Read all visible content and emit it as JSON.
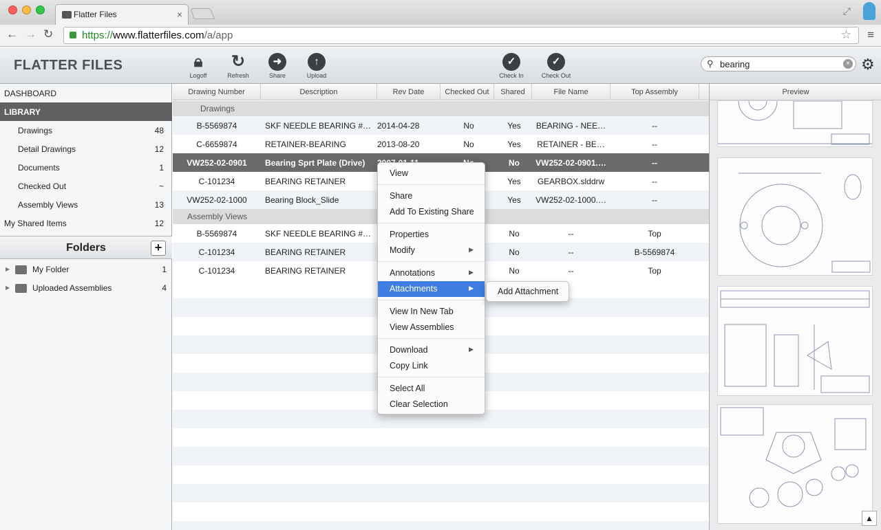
{
  "browser": {
    "tab_title": "Flatter Files",
    "url_scheme": "https://",
    "url_host": "www.flatterfiles.com",
    "url_path": "/a/app"
  },
  "app": {
    "logo": "FLATTER FILES",
    "toolbar": [
      {
        "label": "Logoff",
        "icon": "lock-icon"
      },
      {
        "label": "Refresh",
        "icon": "refresh-icon"
      },
      {
        "label": "Share",
        "icon": "share-arrow-icon"
      },
      {
        "label": "Upload",
        "icon": "upload-icon"
      }
    ],
    "toolbar_right": [
      {
        "label": "Check In",
        "icon": "check-circle-icon"
      },
      {
        "label": "Check Out",
        "icon": "check-circle-icon"
      }
    ],
    "search": {
      "value": "bearing"
    }
  },
  "sidebar": {
    "dashboard": "DASHBOARD",
    "library": "LIBRARY",
    "items": [
      {
        "label": "Drawings",
        "count": "48"
      },
      {
        "label": "Detail Drawings",
        "count": "12"
      },
      {
        "label": "Documents",
        "count": "1"
      },
      {
        "label": "Checked Out",
        "count": "~"
      },
      {
        "label": "Assembly Views",
        "count": "13"
      }
    ],
    "shared": {
      "label": "My Shared Items",
      "count": "12"
    },
    "folders_title": "Folders",
    "add": "+",
    "folders": [
      {
        "label": "My Folder",
        "count": "1"
      },
      {
        "label": "Uploaded Assemblies",
        "count": "4"
      }
    ]
  },
  "columns": [
    "Drawing Number",
    "Description",
    "Rev Date",
    "Checked Out",
    "Shared",
    "File Name",
    "Top Assembly"
  ],
  "groups": {
    "drawings": "Drawings",
    "assembly": "Assembly Views"
  },
  "rows": [
    [
      "B-5569874",
      "SKF NEEDLE BEARING #…",
      "2014-04-28",
      "No",
      "Yes",
      "BEARING - NEE…",
      "--"
    ],
    [
      "C-6659874",
      "RETAINER-BEARING",
      "2013-08-20",
      "No",
      "Yes",
      "RETAINER - BE…",
      "--"
    ],
    [
      "VW252-02-0901",
      "Bearing Sprt  Plate (Drive)",
      "2007-01-11",
      "No",
      "No",
      "VW252-02-0901.…",
      "--"
    ],
    [
      "C-101234",
      "BEARING RETAINER",
      "",
      "",
      "Yes",
      "GEARBOX.slddrw",
      "--"
    ],
    [
      "VW252-02-1000",
      "Bearing Block_Slide",
      "",
      "",
      "Yes",
      "VW252-02-1000.…",
      "--"
    ]
  ],
  "assembly_rows": [
    [
      "B-5569874",
      "SKF NEEDLE BEARING #…",
      "",
      "",
      "No",
      "--",
      "Top"
    ],
    [
      "C-101234",
      "BEARING RETAINER",
      "",
      "",
      "No",
      "--",
      "B-5569874"
    ],
    [
      "C-101234",
      "BEARING RETAINER",
      "",
      "",
      "No",
      "--",
      "Top"
    ]
  ],
  "preview_title": "Preview",
  "context_menu": [
    "View",
    "Share",
    "Add To Existing Share",
    "Properties",
    "Modify",
    "Annotations",
    "Attachments",
    "View In New Tab",
    "View Assemblies",
    "Download",
    "Copy Link",
    "Select All",
    "Clear Selection"
  ],
  "submenu": "Add Attachment"
}
